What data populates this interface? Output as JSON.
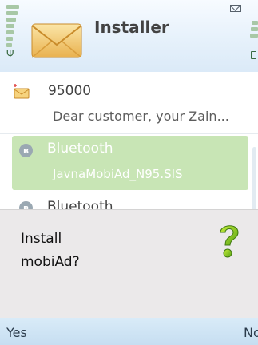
{
  "header": {
    "title": "Installer"
  },
  "messages": [
    {
      "sender": "95000",
      "preview": "Dear customer, your Zain...",
      "icon": "envelope-message-icon"
    },
    {
      "sender": "Bluetooth",
      "preview": "JavnaMobiAd_N95.SIS",
      "icon": "bluetooth-icon",
      "selected": true
    },
    {
      "sender": "Bluetooth",
      "icon": "bluetooth-icon"
    }
  ],
  "dialog": {
    "line1": "Install",
    "line2": "mobiAd?",
    "icon": "question-mark-icon"
  },
  "softkeys": {
    "left": "Yes",
    "right": "No"
  },
  "colors": {
    "highlight": "#c8e5b5",
    "dialog_bg": "#ebe9ea",
    "softkey_bg": "#cfe4f4",
    "header_bg": "#e6f1fb"
  }
}
